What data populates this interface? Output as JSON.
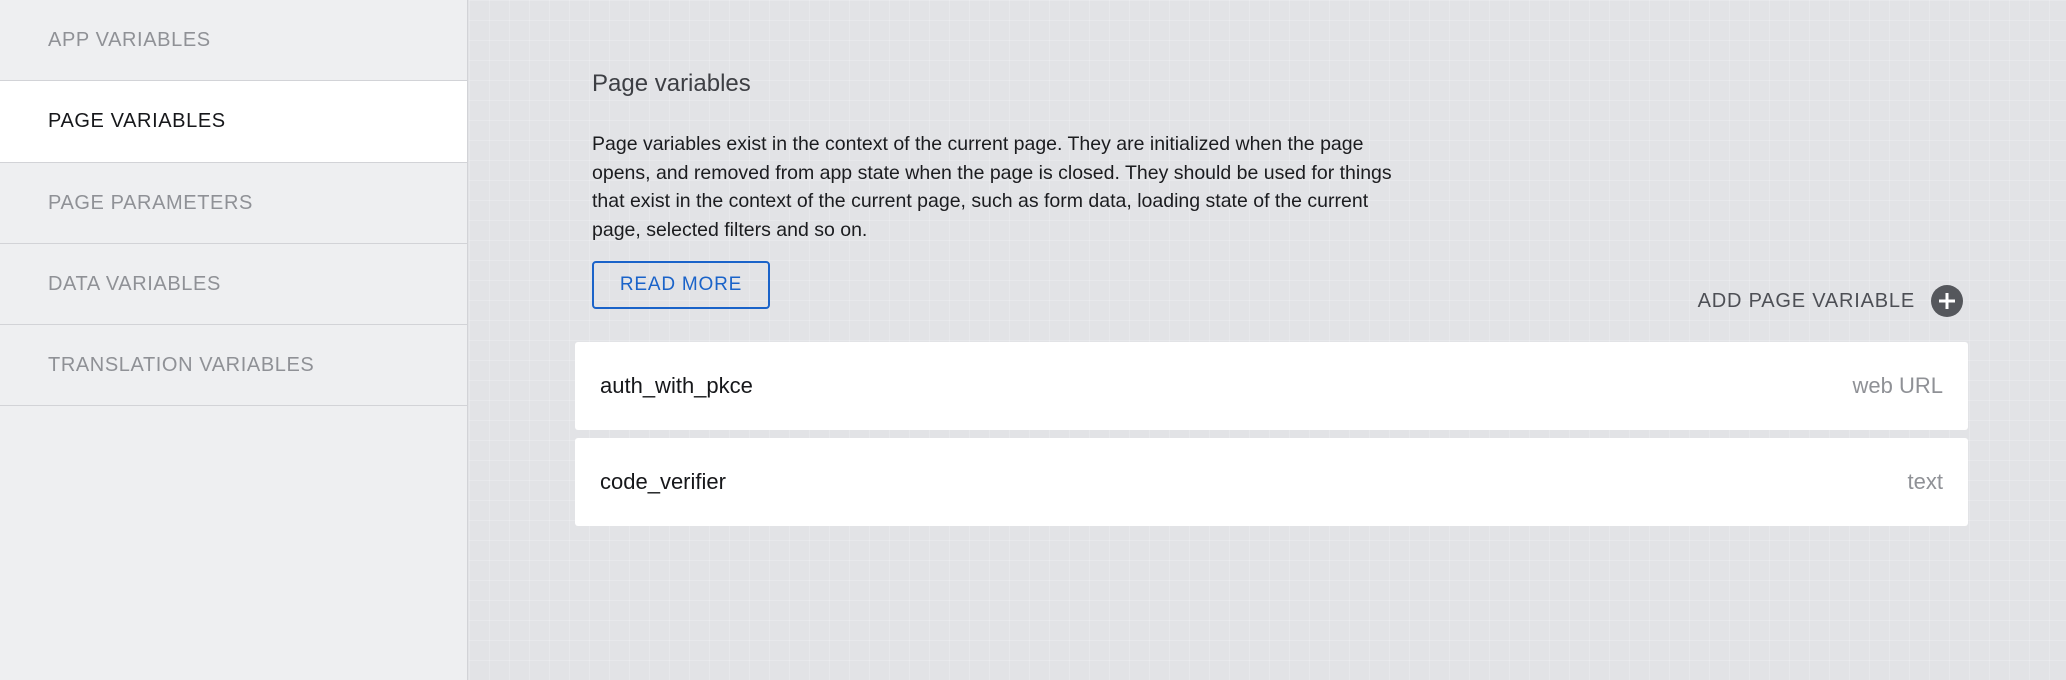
{
  "sidebar": {
    "items": [
      {
        "label": "APP VARIABLES",
        "active": false
      },
      {
        "label": "PAGE VARIABLES",
        "active": true
      },
      {
        "label": "PAGE PARAMETERS",
        "active": false
      },
      {
        "label": "DATA VARIABLES",
        "active": false
      },
      {
        "label": "TRANSLATION VARIABLES",
        "active": false
      }
    ]
  },
  "main": {
    "title": "Page variables",
    "description": "Page variables exist in the context of the current page. They are initialized when the page opens, and removed from app state when the page is closed. They should be used for things that exist in the context of the current page, such as form data, loading state of the current page, selected filters and so on.",
    "read_more_label": "READ MORE",
    "add_variable_label": "ADD PAGE VARIABLE",
    "add_icon": "plus-circle-icon",
    "variables": [
      {
        "name": "auth_with_pkce",
        "type": "web URL"
      },
      {
        "name": "code_verifier",
        "type": "text"
      }
    ]
  },
  "colors": {
    "accent": "#1a63c9",
    "background": "#e2e3e6",
    "sidebar_background": "#eeeff1",
    "active_item_background": "#ffffff"
  }
}
